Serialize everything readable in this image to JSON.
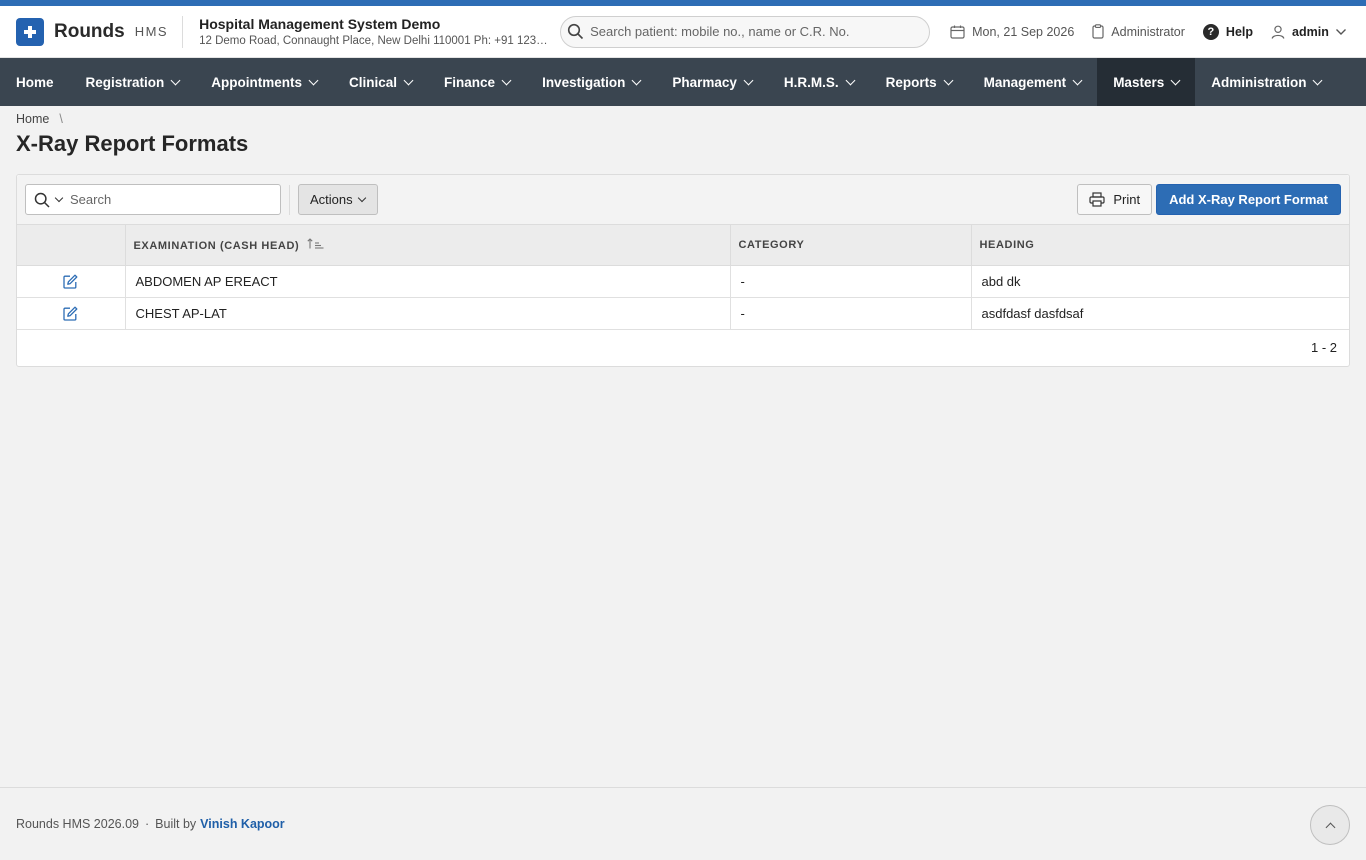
{
  "app": {
    "name": "Rounds",
    "sub": "HMS",
    "hospital_name": "Hospital Management System Demo",
    "hospital_address": "12 Demo Road, Connaught Place, New Delhi 110001 Ph: +91 123…"
  },
  "header": {
    "search_placeholder": "Search patient: mobile no., name or C.R. No.",
    "date": "Mon, 21 Sep 2026",
    "role": "Administrator",
    "help": "Help",
    "user": "admin"
  },
  "nav": [
    {
      "label": "Home",
      "dropdown": false
    },
    {
      "label": "Registration",
      "dropdown": true
    },
    {
      "label": "Appointments",
      "dropdown": true
    },
    {
      "label": "Clinical",
      "dropdown": true
    },
    {
      "label": "Finance",
      "dropdown": true
    },
    {
      "label": "Investigation",
      "dropdown": true
    },
    {
      "label": "Pharmacy",
      "dropdown": true
    },
    {
      "label": "H.R.M.S.",
      "dropdown": true
    },
    {
      "label": "Reports",
      "dropdown": true
    },
    {
      "label": "Management",
      "dropdown": true
    },
    {
      "label": "Masters",
      "dropdown": true,
      "active": true
    },
    {
      "label": "Administration",
      "dropdown": true
    }
  ],
  "breadcrumb": {
    "home": "Home",
    "sep": "\\"
  },
  "page": {
    "title": "X-Ray Report Formats"
  },
  "toolbar": {
    "search_placeholder": "Search",
    "actions_label": "Actions",
    "print_label": "Print",
    "add_label": "Add X-Ray Report Format"
  },
  "table": {
    "columns": [
      "EXAMINATION (CASH HEAD)",
      "CATEGORY",
      "HEADING"
    ],
    "rows": [
      {
        "examination": "ABDOMEN AP EREACT",
        "category": "-",
        "heading": "abd dk"
      },
      {
        "examination": "CHEST AP-LAT",
        "category": "-",
        "heading": "asdfdasf dasfdsaf"
      }
    ],
    "pagination": "1 - 2"
  },
  "footer": {
    "version": "Rounds HMS 2026.09",
    "built_by": "Built by",
    "author": "Vinish Kapoor"
  },
  "colors": {
    "brand": "#2d6db5",
    "nav_bg": "#3a4550",
    "nav_active": "#252d35"
  }
}
